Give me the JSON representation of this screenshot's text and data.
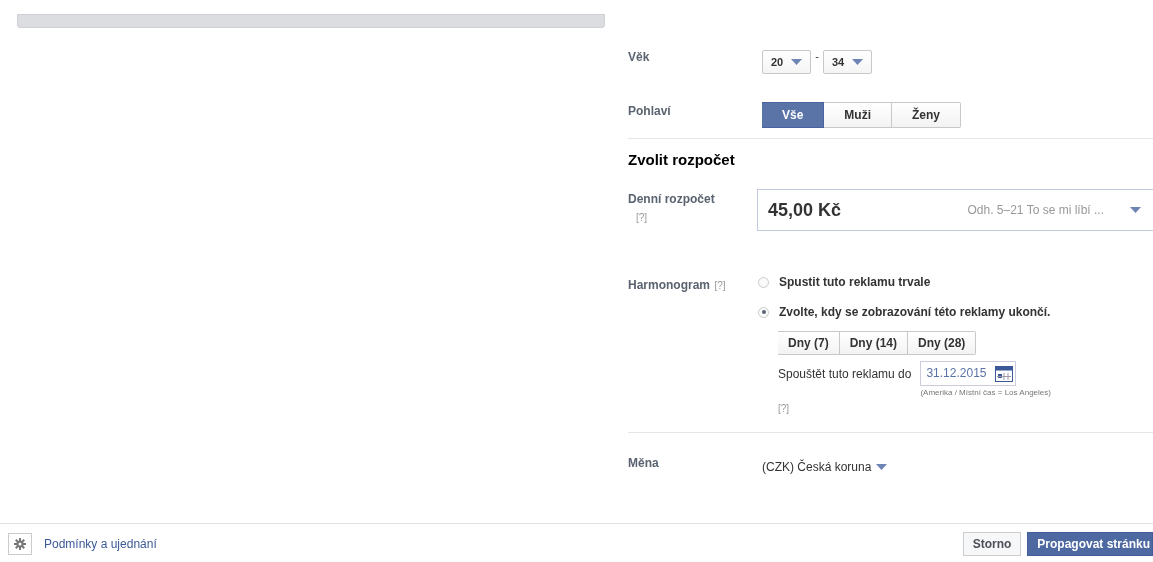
{
  "age": {
    "label": "Věk",
    "from": "20",
    "separator": "-",
    "to": "34"
  },
  "gender": {
    "label": "Pohlaví",
    "options": [
      {
        "label": "Vše",
        "selected": true
      },
      {
        "label": "Muži",
        "selected": false
      },
      {
        "label": "Ženy",
        "selected": false
      }
    ]
  },
  "budget_heading": "Zvolit rozpočet",
  "daily_budget": {
    "label": "Denní rozpočet",
    "help": "[?]",
    "value": "45,00 Kč",
    "estimate": "Odh. 5–21 To se mi líbí ..."
  },
  "schedule": {
    "label": "Harmonogram",
    "help": "[?]",
    "options": [
      {
        "label": "Spustit tuto reklamu trvale",
        "selected": false
      },
      {
        "label": "Zvolte, kdy se zobrazování této reklamy ukončí.",
        "selected": true
      }
    ],
    "presets": [
      "Dny (7)",
      "Dny (14)",
      "Dny (28)"
    ],
    "end_label": "Spouštět tuto reklamu do",
    "end_date": "31.12.2015",
    "timezone": "(Amerika / Místní čas = Los Angeles)",
    "end_help": "[?]"
  },
  "currency": {
    "label": "Měna",
    "value": "(CZK) Česká koruna"
  },
  "footer": {
    "terms_link": "Podmínky a ujednání",
    "buttons": [
      {
        "label": "Storno",
        "kind": "secondary"
      },
      {
        "label": "Propagovat stránku",
        "kind": "primary"
      }
    ]
  }
}
